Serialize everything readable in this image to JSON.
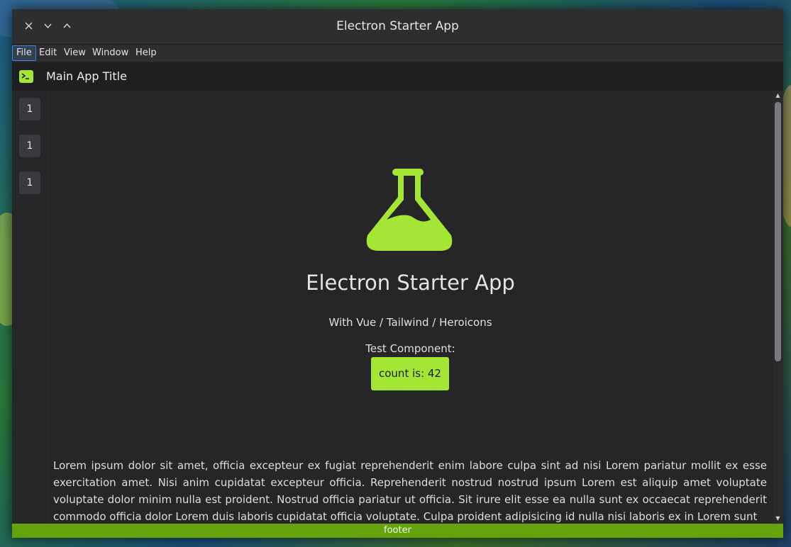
{
  "window": {
    "title": "Electron Starter App",
    "controls": {
      "close": "×",
      "minimize": "⌄",
      "maximize": "⌃"
    }
  },
  "menu": [
    "File",
    "Edit",
    "View",
    "Window",
    "Help"
  ],
  "appbar": {
    "icon": "terminal-icon",
    "title": "Main App Title"
  },
  "sidebar": {
    "buttons": [
      "1",
      "1",
      "1"
    ]
  },
  "hero": {
    "icon": "flask-icon",
    "title": "Electron Starter App",
    "subtitle": "With Vue / Tailwind / Heroicons",
    "test_label": "Test Component:",
    "count_button": "count is: 42"
  },
  "body_text": "Lorem ipsum dolor sit amet, officia excepteur ex fugiat reprehenderit enim labore culpa sint ad nisi Lorem pariatur mollit ex esse exercitation amet. Nisi anim cupidatat excepteur officia. Reprehenderit nostrud nostrud ipsum Lorem est aliquip amet voluptate voluptate dolor minim nulla est proident. Nostrud officia pariatur ut officia. Sit irure elit esse ea nulla sunt ex occaecat reprehenderit commodo officia dolor Lorem duis laboris cupidatat officia voluptate. Culpa proident adipisicing id nulla nisi laboris ex in Lorem sunt",
  "footer": "footer",
  "colors": {
    "accent": "#a3e635",
    "footer": "#65a30d",
    "background": "#262528"
  }
}
